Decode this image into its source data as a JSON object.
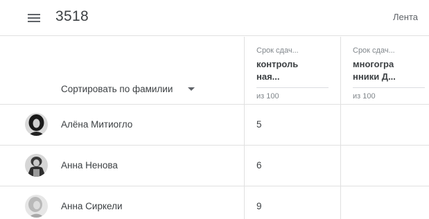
{
  "header": {
    "class_name": "3518",
    "feed_link": "Лента"
  },
  "sort": {
    "label": "Сортировать по фамилии"
  },
  "assignments": [
    {
      "due": "Срок сдач...",
      "title": "контроль\nная...",
      "max_points": "из 100"
    },
    {
      "due": "Срок сдач...",
      "title": "многогра\nнники Д...",
      "max_points": "из 100"
    }
  ],
  "students": [
    {
      "name": "Алёна Митиогло",
      "grades": [
        "5",
        ""
      ],
      "avatar": "photo-dark-hair"
    },
    {
      "name": "Анна Ненова",
      "grades": [
        "6",
        ""
      ],
      "avatar": "photo-winter"
    },
    {
      "name": "Анна Сиркели",
      "grades": [
        "9",
        ""
      ],
      "avatar": "photo-light"
    }
  ],
  "colors": {
    "divider": "#e0e0e0",
    "text": "#3c4043",
    "muted": "#80868b"
  }
}
